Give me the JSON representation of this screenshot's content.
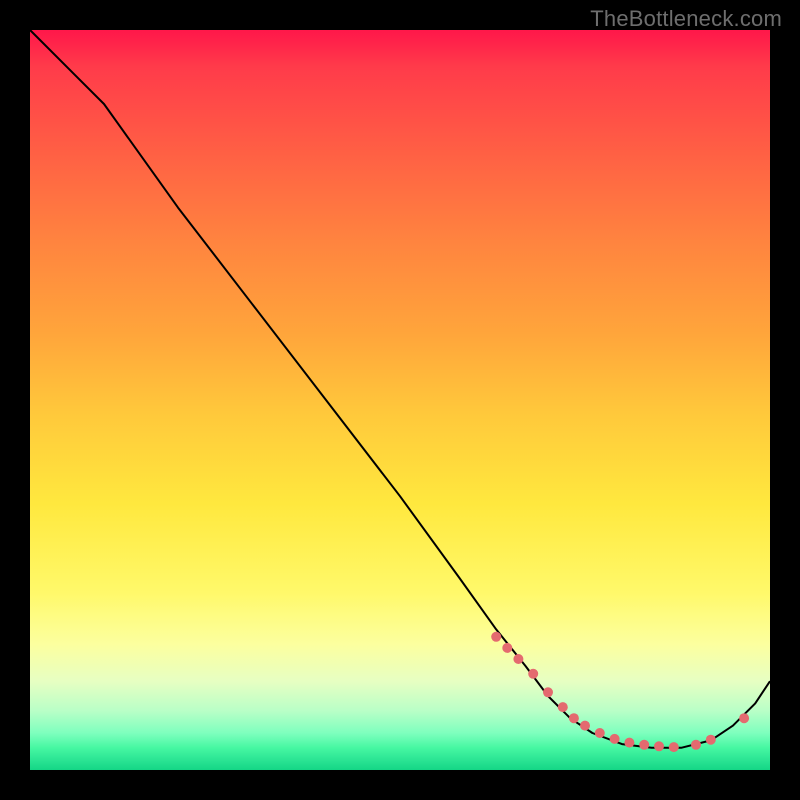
{
  "watermark": "TheBottleneck.com",
  "chart_data": {
    "type": "line",
    "title": "",
    "xlabel": "",
    "ylabel": "",
    "xlim": [
      0,
      100
    ],
    "ylim": [
      0,
      100
    ],
    "curve": {
      "x": [
        0,
        6,
        10,
        20,
        30,
        40,
        50,
        58,
        63,
        67,
        70,
        73,
        76,
        80,
        84,
        88,
        92,
        95,
        98,
        100
      ],
      "y": [
        100,
        94,
        90,
        76,
        63,
        50,
        37,
        26,
        19,
        14,
        10,
        7,
        5,
        3.5,
        3,
        3,
        4,
        6,
        9,
        12
      ]
    },
    "markers": {
      "x": [
        63,
        64.5,
        66,
        68,
        70,
        72,
        73.5,
        75,
        77,
        79,
        81,
        83,
        85,
        87,
        90,
        92,
        96.5
      ],
      "y": [
        18,
        16.5,
        15,
        13,
        10.5,
        8.5,
        7,
        6,
        5,
        4.2,
        3.7,
        3.4,
        3.2,
        3.1,
        3.4,
        4.1,
        7
      ]
    }
  }
}
